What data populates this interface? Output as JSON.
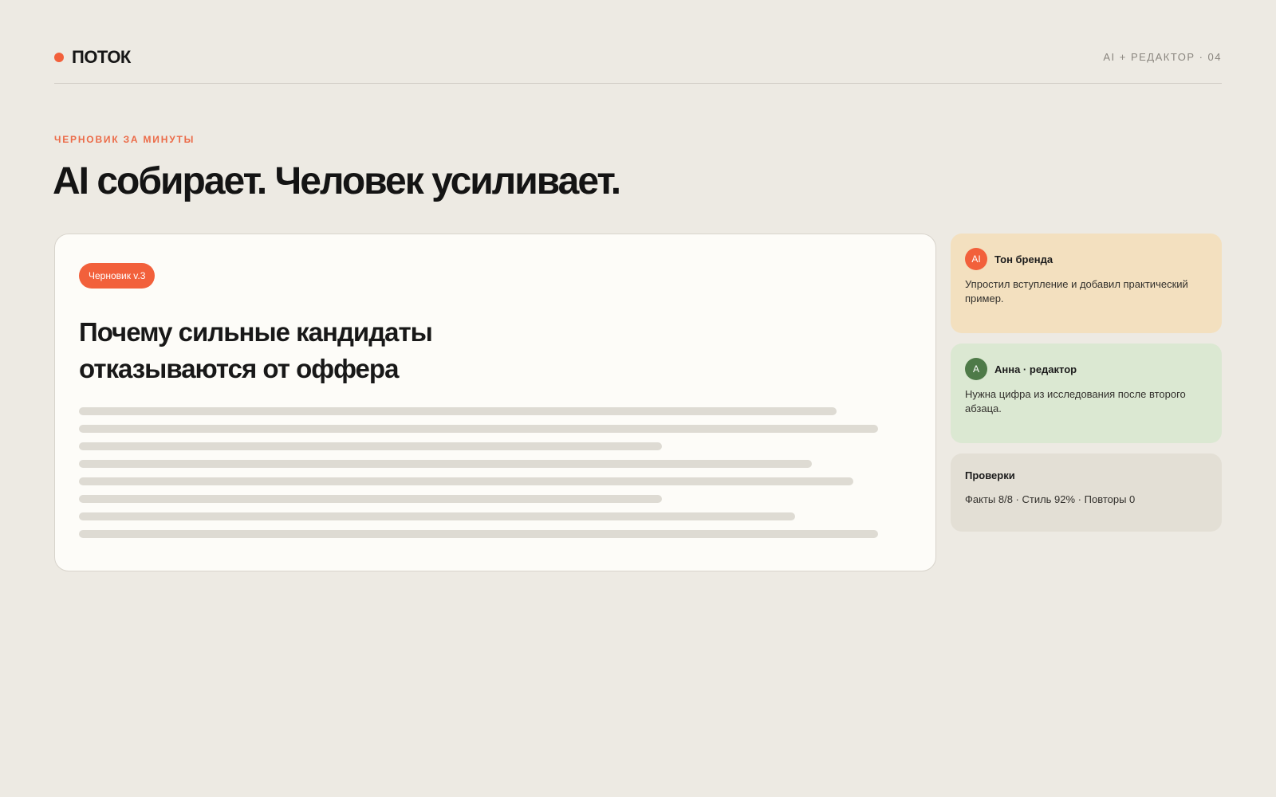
{
  "header": {
    "brand": "ПОТОК",
    "meta": "AI + РЕДАКТОР · 04"
  },
  "hero": {
    "eyebrow": "ЧЕРНОВИК ЗА МИНУТЫ",
    "headline": "AI собирает. Человек усиливает."
  },
  "draft": {
    "badge": "Черновик v.3",
    "title": "Почему сильные кандидаты отказываются от оффера"
  },
  "comments": [
    {
      "avatar": "AI",
      "title": "Тон бренда",
      "text": "Упростил вступление и добавил практический пример.",
      "avatar_color": "#f2603b",
      "card_color": "#f3e0bf"
    },
    {
      "avatar": "A",
      "title": "Анна · редактор",
      "text": "Нужна цифра из исследования после второго абзаца.",
      "avatar_color": "#4e7a48",
      "card_color": "#dbe8d2"
    }
  ],
  "checks": {
    "title": "Проверки",
    "text": "Факты 8/8 · Стиль 92% · Повторы 0",
    "card_color": "#e3dfd5"
  },
  "colors": {
    "accent": "#f2603b",
    "background": "#edeae3"
  }
}
